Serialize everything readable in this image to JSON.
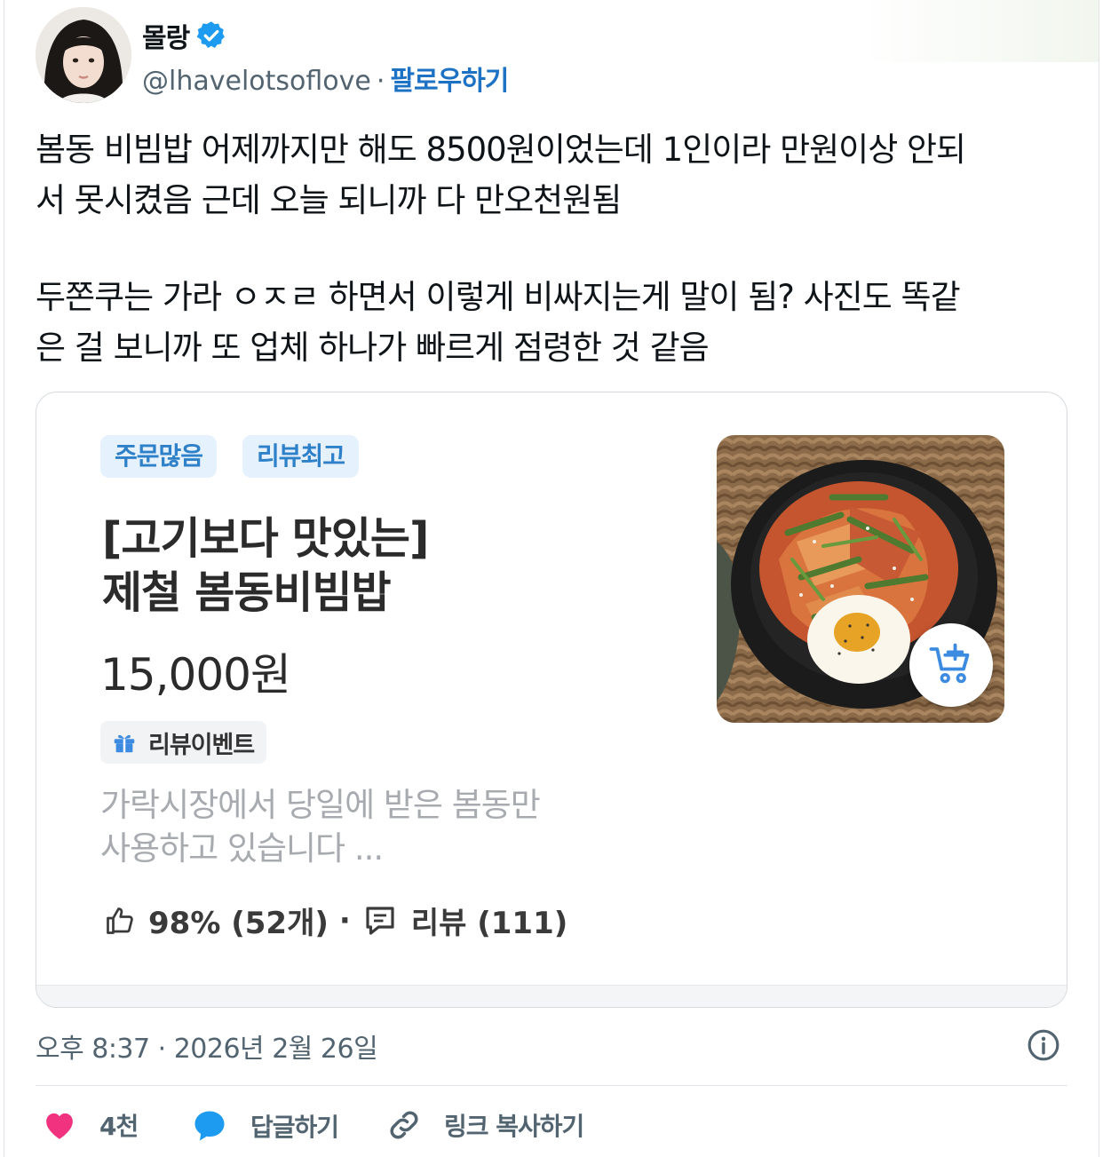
{
  "author": {
    "name": "몰랑",
    "handle": "@lhavelotsoflove",
    "separator": "·",
    "follow_label": "팔로우하기"
  },
  "tweet": {
    "paragraph1": "봄동 비빔밥 어제까지만 해도 8500원이었는데 1인이라 만원이상 안되\n서 못시켰음 근데 오늘 되니까 다 만오천원됨",
    "paragraph2": "두쫀쿠는 가라 ㅇㅈㄹ 하면서 이렇게 비싸지는게 말이 됨? 사진도 똑같\n은 걸 보니까 또 업체 하나가 빠르게 점령한 것 같음"
  },
  "card": {
    "tags": [
      "주문많음",
      "리뷰최고"
    ],
    "title": "[고기보다 맛있는]\n제철 봄동비빔밥",
    "price": "15,000원",
    "event_label": "리뷰이벤트",
    "description": "가락시장에서 당일에 받은 봄동만\n사용하고 있습니다 ...",
    "rating": "98% (52개)",
    "stats_separator": "·",
    "reviews": "리뷰 (111)"
  },
  "meta": {
    "timestamp": "오후 8:37 · 2026년 2월 26일"
  },
  "actions": {
    "like_count": "4천",
    "reply_label": "답글하기",
    "copy_link_label": "링크 복사하기"
  },
  "colors": {
    "follow": "#1d72c4",
    "tag_bg": "#e5f2fd",
    "tag_text": "#2e80c9",
    "like": "#f0327f",
    "reply": "#1d9bf0"
  }
}
